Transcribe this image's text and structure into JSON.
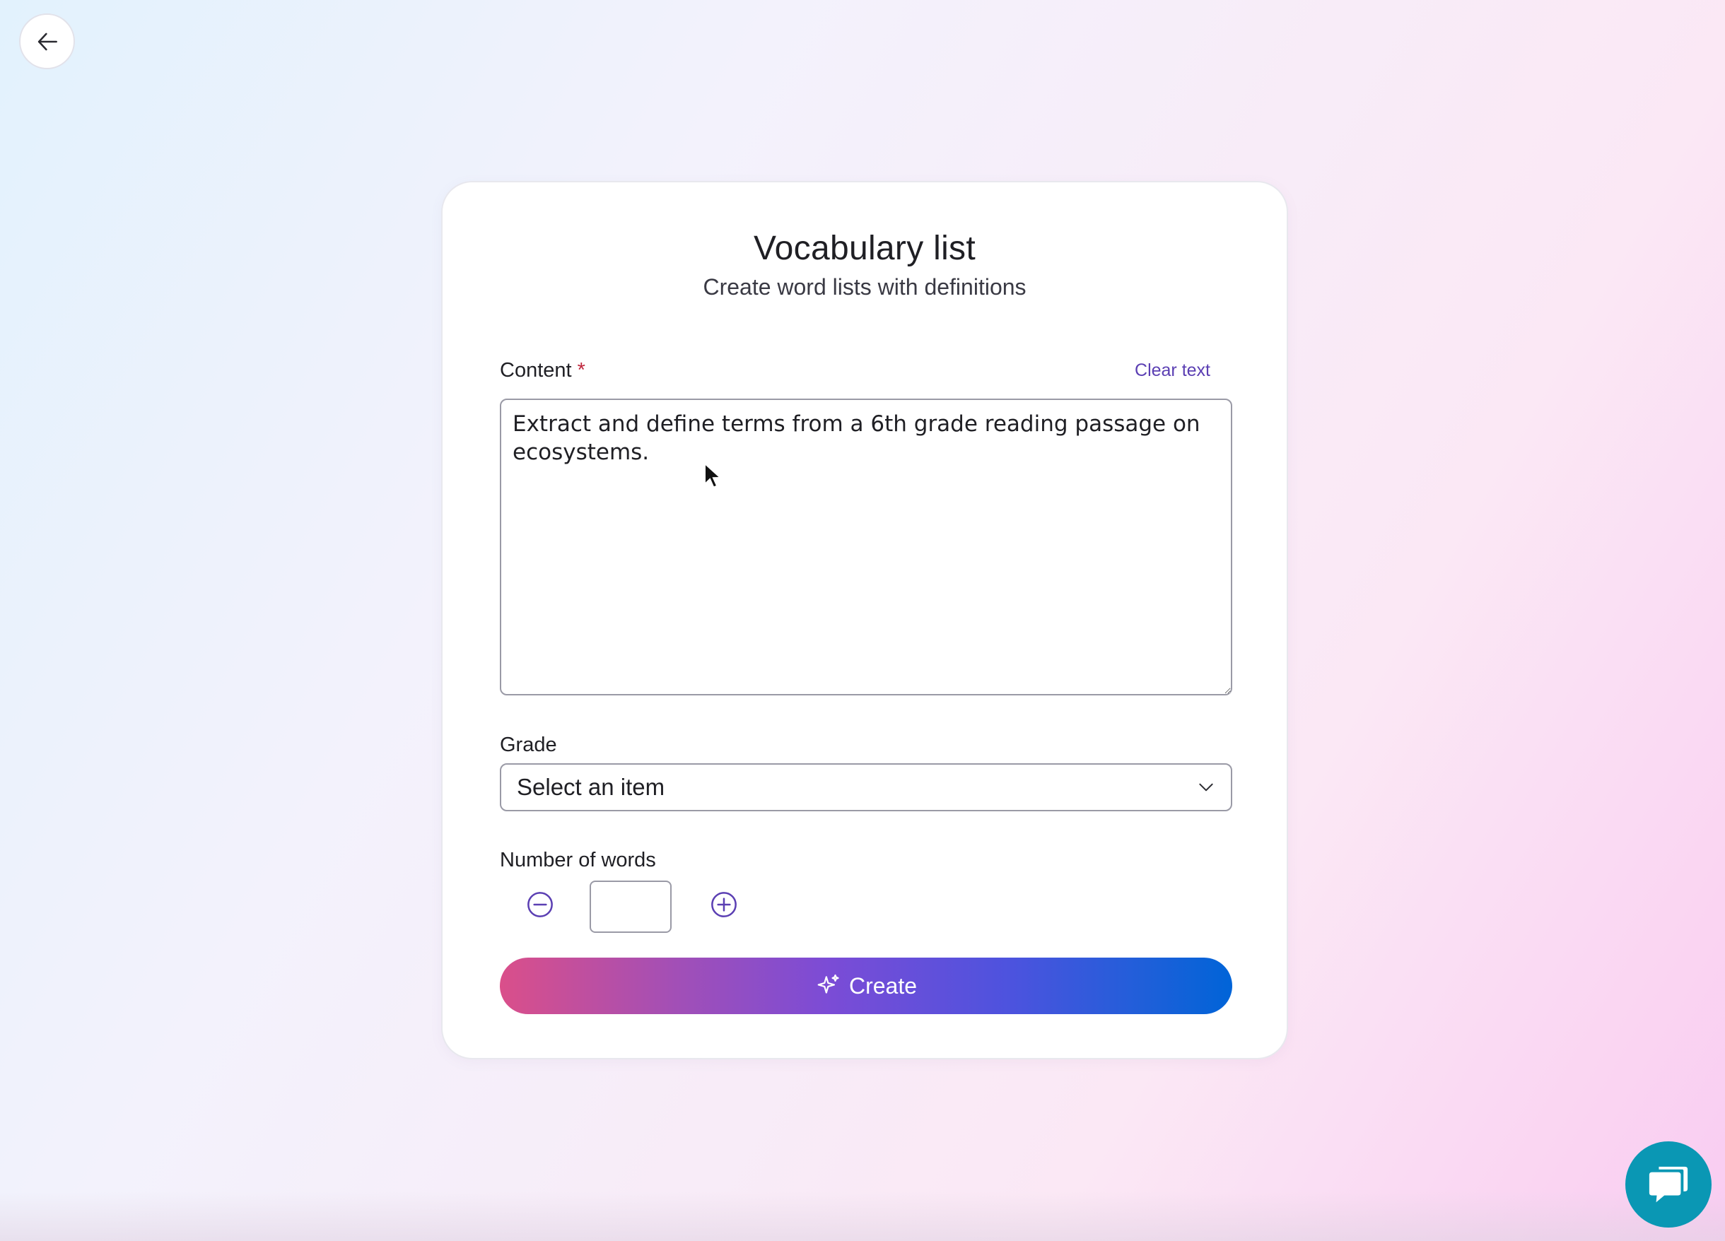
{
  "header": {
    "back_icon": "arrow-left-icon"
  },
  "card": {
    "title": "Vocabulary list",
    "subtitle": "Create word lists with definitions"
  },
  "content": {
    "label": "Content",
    "required_mark": "*",
    "clear_label": "Clear text",
    "value": "Extract and define terms from a 6th grade reading passage on ecosystems."
  },
  "grade": {
    "label": "Grade",
    "selected": "Select an item",
    "icon": "chevron-down-icon"
  },
  "words": {
    "label": "Number of words",
    "value": "",
    "minus_icon": "minus-circle-icon",
    "plus_icon": "plus-circle-icon"
  },
  "create": {
    "label": "Create",
    "icon": "sparkle-icon"
  },
  "chat": {
    "icon": "chat-bubble-icon"
  },
  "colors": {
    "accent": "#5b3fb3",
    "required": "#c0273d",
    "gradient_start": "#da4f8a",
    "gradient_end": "#0064d8",
    "chat": "#0a97b4"
  }
}
